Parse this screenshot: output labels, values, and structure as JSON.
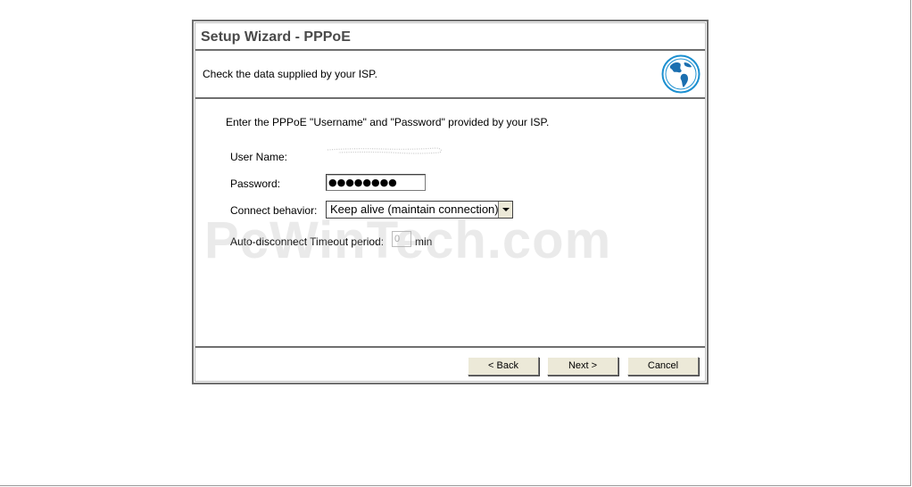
{
  "wizard": {
    "title": "Setup Wizard - PPPoE",
    "subtitle": "Check the data supplied by your ISP.",
    "globe_icon": "globe-icon"
  },
  "form": {
    "intro": "Enter the PPPoE \"Username\" and \"Password\" provided by your ISP.",
    "username_label": "User Name:",
    "password_label": "Password:",
    "password_value": "●●●●●●●●",
    "connect_label": "Connect behavior:",
    "connect_value": "Keep alive (maintain connection)",
    "timeout_label": "Auto-disconnect Timeout period:",
    "timeout_value": "0",
    "timeout_unit": "min"
  },
  "buttons": {
    "back": "< Back",
    "next": "Next >",
    "cancel": "Cancel"
  },
  "watermark": "PcWinTech.com",
  "colors": {
    "border": "#6f6f6f",
    "button_face": "#ece9d8",
    "title_text": "#4a4a4a",
    "globe_ocean": "#1b8fd0",
    "globe_land": "#3a7ab8"
  }
}
